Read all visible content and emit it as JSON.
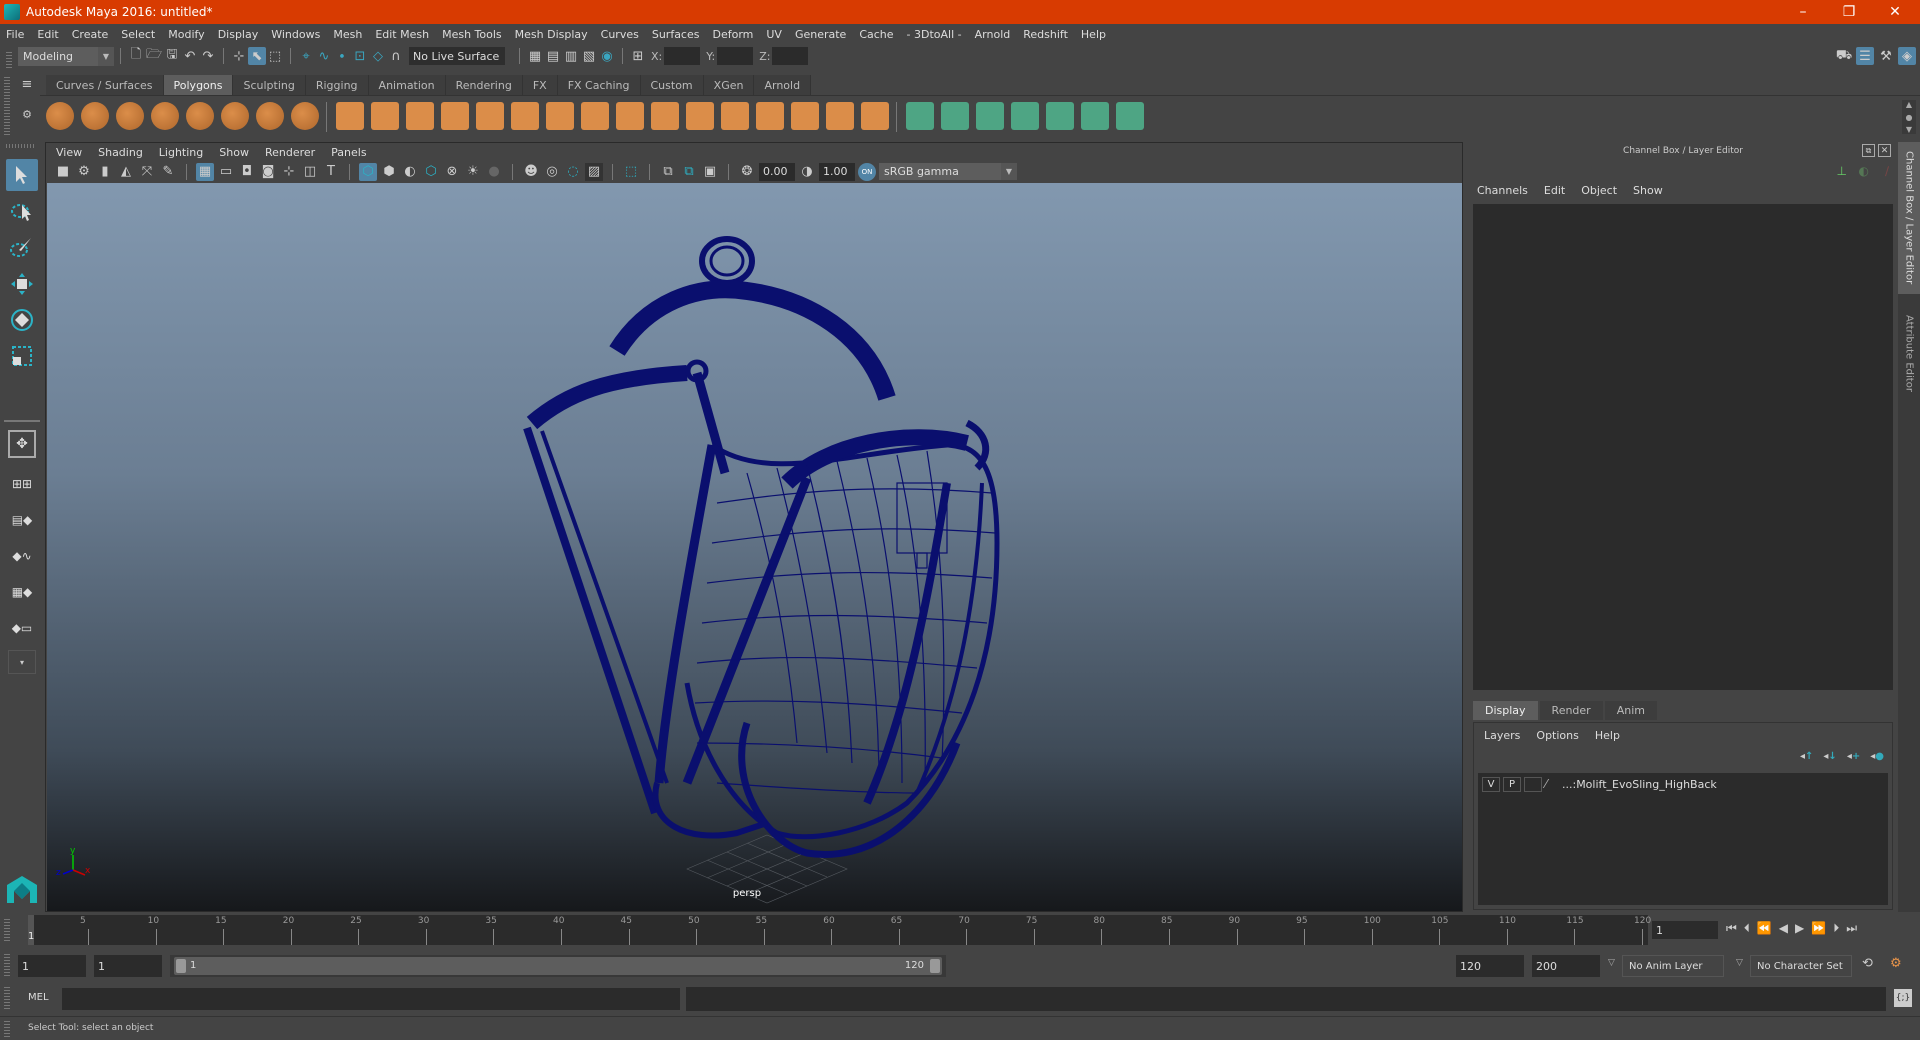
{
  "window": {
    "title": "Autodesk Maya 2016: untitled*",
    "controls": {
      "minimize": "–",
      "restore": "❐",
      "close": "✕"
    }
  },
  "menubar": [
    "File",
    "Edit",
    "Create",
    "Select",
    "Modify",
    "Display",
    "Windows",
    "Mesh",
    "Edit Mesh",
    "Mesh Tools",
    "Mesh Display",
    "Curves",
    "Surfaces",
    "Deform",
    "UV",
    "Generate",
    "Cache",
    "- 3DtoAll -",
    "Arnold",
    "Redshift",
    "Help"
  ],
  "statusline": {
    "menuset": "Modeling",
    "live_surface": "No Live Surface",
    "x_label": "X:",
    "y_label": "Y:",
    "z_label": "Z:",
    "x_value": "",
    "y_value": "",
    "z_value": ""
  },
  "shelf": {
    "tabs": [
      "Curves / Surfaces",
      "Polygons",
      "Sculpting",
      "Rigging",
      "Animation",
      "Rendering",
      "FX",
      "FX Caching",
      "Custom",
      "XGen",
      "Arnold"
    ],
    "active_tab": "Polygons",
    "icons": [
      "poly-sphere",
      "poly-cube",
      "poly-cylinder",
      "poly-cone",
      "poly-plane",
      "poly-torus",
      "poly-pyramid",
      "poly-pipe",
      "combine",
      "separate",
      "extract",
      "smooth",
      "booleans",
      "average-vertices",
      "bridge",
      "extrude",
      "multi-cut",
      "bevel",
      "append-polygon",
      "fill-hole",
      "insert-edge-loop",
      "offset-edge-loop",
      "merge",
      "planar-uv",
      "automatic-uv",
      "cylindrical-uv",
      "spherical-uv",
      "unfold",
      "layout-uv",
      "uv-editor",
      "transfer-attributes"
    ]
  },
  "viewport": {
    "menus": [
      "View",
      "Shading",
      "Lighting",
      "Show",
      "Renderer",
      "Panels"
    ],
    "exposure": "0.00",
    "gamma": "1.00",
    "color_space": "sRGB gamma",
    "camera_label": "persp",
    "axis": {
      "x": "x",
      "y": "y",
      "z": "z"
    },
    "wire_color": "#0a0f6e"
  },
  "channelbox": {
    "title": "Channel Box / Layer Editor",
    "menus": [
      "Channels",
      "Edit",
      "Object",
      "Show"
    ]
  },
  "layereditor": {
    "tabs": [
      "Display",
      "Render",
      "Anim"
    ],
    "active_tab": "Display",
    "menus": [
      "Layers",
      "Options",
      "Help"
    ],
    "layers": [
      {
        "v": "V",
        "p": "P",
        "name": "...:Molift_EvoSling_HighBack"
      }
    ]
  },
  "sidetabs": [
    "Channel Box / Layer Editor",
    "Attribute Editor"
  ],
  "timeline": {
    "ticks": [
      5,
      10,
      15,
      20,
      25,
      30,
      35,
      40,
      45,
      50,
      55,
      60,
      65,
      70,
      75,
      80,
      85,
      90,
      95,
      100,
      105,
      110,
      115,
      120
    ],
    "current_frame_label": "1",
    "current_frame": "1"
  },
  "range": {
    "start": "1",
    "playback_start": "1",
    "slider_start": "1",
    "slider_end": "120",
    "playback_end": "120",
    "end": "200",
    "anim_layer": "No Anim Layer",
    "character_set": "No Character Set"
  },
  "mel": {
    "label": "MEL",
    "input": ""
  },
  "help_line": "Select Tool: select an object",
  "colors": {
    "titlebar": "#d83b01",
    "accent": "#5285a6",
    "shelf_orange": "#e8944a",
    "shelf_green": "#4fae8a"
  }
}
